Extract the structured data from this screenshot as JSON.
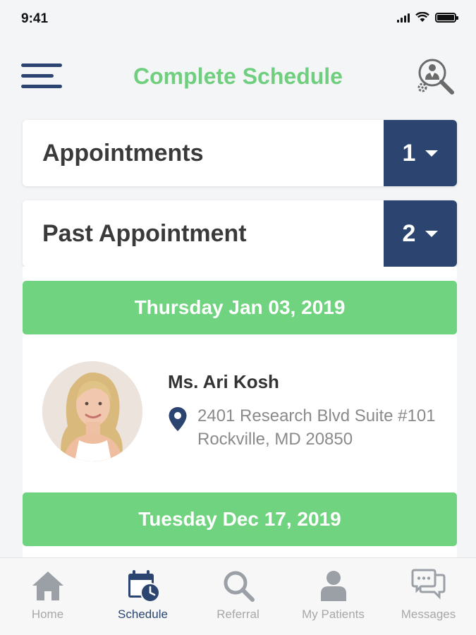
{
  "status_bar": {
    "time": "9:41"
  },
  "header": {
    "title": "Complete Schedule",
    "menu_icon": "hamburger-icon",
    "action_icon": "doctor-search-icon"
  },
  "sections": [
    {
      "label": "Appointments",
      "count": "1"
    },
    {
      "label": "Past Appointment",
      "count": "2"
    }
  ],
  "past_appointments": [
    {
      "date": "Thursday Jan 03, 2019",
      "doctor": "Ms. Ari Kosh",
      "address_line1": "2401 Research Blvd Suite #101",
      "address_line2": "Rockville, MD 20850"
    },
    {
      "date": "Tuesday Dec 17, 2019"
    }
  ],
  "tab_bar": {
    "items": [
      {
        "label": "Home",
        "icon": "home-icon"
      },
      {
        "label": "Schedule",
        "icon": "calendar-clock-icon"
      },
      {
        "label": "Referral",
        "icon": "search-icon"
      },
      {
        "label": "My Patients",
        "icon": "person-icon"
      },
      {
        "label": "Messages",
        "icon": "chat-bubbles-icon"
      }
    ],
    "active": "Schedule"
  },
  "colors": {
    "primary_navy": "#2b4570",
    "accent_green": "#6fd37f",
    "title_green": "#6fcf7f"
  }
}
